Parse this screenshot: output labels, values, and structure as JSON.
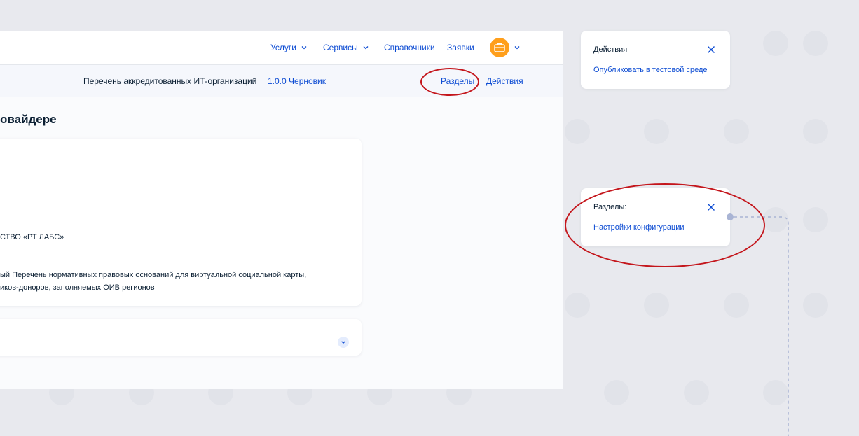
{
  "nav": {
    "items": [
      {
        "label": "Услуги",
        "has_chevron": true
      },
      {
        "label": "Сервисы",
        "has_chevron": true
      },
      {
        "label": "Справочники",
        "has_chevron": false
      },
      {
        "label": "Заявки",
        "has_chevron": false
      }
    ],
    "avatar_icon": "briefcase-icon"
  },
  "subbar": {
    "registry_title": "Перечень аккредитованных ИТ-организаций",
    "version_link": "1.0.0 Черновик",
    "sections_link": "Разделы",
    "actions_link": "Действия"
  },
  "main": {
    "page_title_partial": "овайдере",
    "card": {
      "line_provider": "СТВО «РТ ЛАБС»",
      "line_desc_1": "ый Перечень нормативных правовых оснований для виртуальной социальной карты,",
      "line_desc_2": "иков-доноров, заполняемых ОИВ регионов"
    }
  },
  "actions_panel": {
    "title": "Действия",
    "link": "Опубликовать в тестовой среде"
  },
  "sections_panel": {
    "title": "Разделы:",
    "link": "Настройки конфигурации"
  },
  "colors": {
    "accent": "#0d4cd3",
    "annotation": "#c4161c",
    "avatar": "#ff9f1c"
  }
}
